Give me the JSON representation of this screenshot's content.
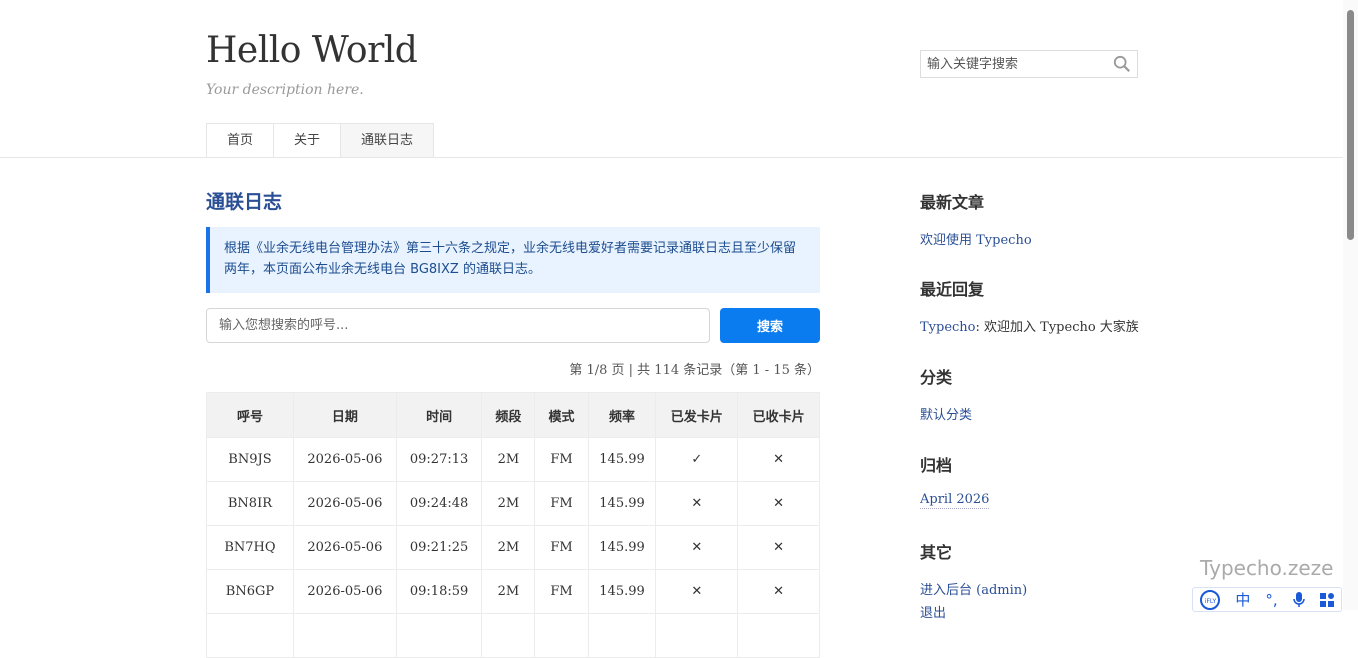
{
  "header": {
    "title": "Hello World",
    "description": "Your description here.",
    "search_placeholder": "输入关键字搜索",
    "nav": [
      "首页",
      "关于",
      "通联日志"
    ]
  },
  "main": {
    "title": "通联日志",
    "notice": "根据《业余无线电台管理办法》第三十六条之规定，业余无线电爱好者需要记录通联日志且至少保留两年，本页面公布业余无线电台 BG8IXZ 的通联日志。",
    "callsign_placeholder": "输入您想搜索的呼号...",
    "search_button": "搜索",
    "pager": "第 1/8 页 | 共 114 条记录（第 1 - 15 条）",
    "table": {
      "headers": [
        "呼号",
        "日期",
        "时间",
        "频段",
        "模式",
        "频率",
        "已发卡片",
        "已收卡片"
      ],
      "rows": [
        [
          "BN9JS",
          "2026-05-06",
          "09:27:13",
          "2M",
          "FM",
          "145.99",
          "✓",
          "✕"
        ],
        [
          "BN8IR",
          "2026-05-06",
          "09:24:48",
          "2M",
          "FM",
          "145.99",
          "✕",
          "✕"
        ],
        [
          "BN7HQ",
          "2026-05-06",
          "09:21:25",
          "2M",
          "FM",
          "145.99",
          "✕",
          "✕"
        ],
        [
          "BN6GP",
          "2026-05-06",
          "09:18:59",
          "2M",
          "FM",
          "145.99",
          "✕",
          "✕"
        ]
      ]
    }
  },
  "sidebar": {
    "recent_posts_title": "最新文章",
    "recent_post": "欢迎使用 Typecho",
    "recent_comments_title": "最近回复",
    "comment_author": "Typecho",
    "comment_text": ": 欢迎加入 Typecho 大家族",
    "categories_title": "分类",
    "category": "默认分类",
    "archives_title": "归档",
    "archive": "April 2026",
    "other_title": "其它",
    "admin_link": "进入后台 (admin)",
    "logout": "退出"
  },
  "overlay": {
    "watermark": "Typecho.zeze",
    "ime": [
      "iFLY",
      "中",
      "°,",
      "mic",
      "grid"
    ]
  },
  "colors": {
    "accent": "#0a7cf0",
    "link": "#2b4f95",
    "notice_bg": "#e8f3ff"
  }
}
